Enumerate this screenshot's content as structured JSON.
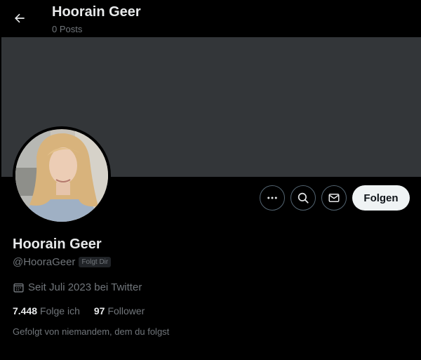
{
  "header": {
    "title": "Hoorain Geer",
    "subtitle": "0 Posts",
    "back_icon": "arrow-left-icon"
  },
  "profile": {
    "display_name": "Hoorain Geer",
    "handle": "@HooraGeer",
    "follows_you_badge": "Folgt Dir",
    "joined": "Seit Juli 2023 bei Twitter",
    "following_count": "7.448",
    "following_label": "Folge ich",
    "followers_count": "97",
    "followers_label": "Follower",
    "followed_by_text": "Gefolgt von niemandem, dem du folgst"
  },
  "actions": {
    "more_icon": "more-icon",
    "search_icon": "search-icon",
    "message_icon": "mail-icon",
    "follow_label": "Folgen"
  },
  "colors": {
    "background": "#000000",
    "banner": "#333639",
    "text_primary": "#e7e9ea",
    "text_secondary": "#71767b",
    "follow_button": "#eff3f4"
  }
}
